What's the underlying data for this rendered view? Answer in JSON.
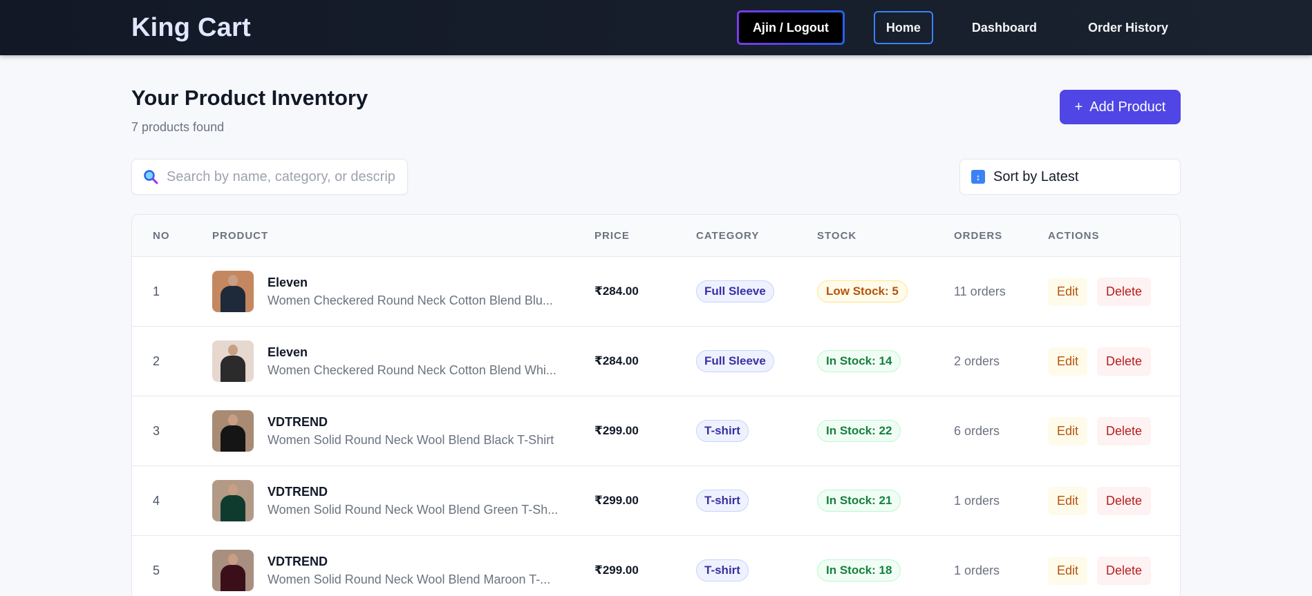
{
  "nav": {
    "brand": "King Cart",
    "logout_label": "Ajin / Logout",
    "links": [
      "Home",
      "Dashboard",
      "Order History"
    ]
  },
  "header": {
    "title": "Your Product Inventory",
    "count_text": "7 products found",
    "add_button": "Add Product",
    "add_icon": "+"
  },
  "search": {
    "placeholder": "Search by name, category, or description",
    "value": ""
  },
  "sort": {
    "label": "Sort by Latest"
  },
  "table": {
    "headers": [
      "NO",
      "PRODUCT",
      "PRICE",
      "CATEGORY",
      "STOCK",
      "ORDERS",
      "ACTIONS"
    ],
    "rows": [
      {
        "no": "1",
        "name": "Eleven",
        "desc": "Women Checkered Round Neck Cotton Blend Blu...",
        "price": "₹284.00",
        "category": "Full Sleeve",
        "stock": "Low Stock: 5",
        "stock_status": "low",
        "orders": "11 orders",
        "edit": "Edit",
        "delete": "Delete",
        "thumb_colors": [
          "#c58760",
          "#1e2a3a"
        ]
      },
      {
        "no": "2",
        "name": "Eleven",
        "desc": "Women Checkered Round Neck Cotton Blend Whi...",
        "price": "₹284.00",
        "category": "Full Sleeve",
        "stock": "In Stock: 14",
        "stock_status": "in",
        "orders": "2 orders",
        "edit": "Edit",
        "delete": "Delete",
        "thumb_colors": [
          "#e6d8cf",
          "#2b2b2b"
        ]
      },
      {
        "no": "3",
        "name": "VDTREND",
        "desc": "Women Solid Round Neck Wool Blend Black T-Shirt",
        "price": "₹299.00",
        "category": "T-shirt",
        "stock": "In Stock: 22",
        "stock_status": "in",
        "orders": "6 orders",
        "edit": "Edit",
        "delete": "Delete",
        "thumb_colors": [
          "#a98a72",
          "#151515"
        ]
      },
      {
        "no": "4",
        "name": "VDTREND",
        "desc": "Women Solid Round Neck Wool Blend Green T-Sh...",
        "price": "₹299.00",
        "category": "T-shirt",
        "stock": "In Stock: 21",
        "stock_status": "in",
        "orders": "1 orders",
        "edit": "Edit",
        "delete": "Delete",
        "thumb_colors": [
          "#b39a86",
          "#0f3b2e"
        ]
      },
      {
        "no": "5",
        "name": "VDTREND",
        "desc": "Women Solid Round Neck Wool Blend Maroon T-...",
        "price": "₹299.00",
        "category": "T-shirt",
        "stock": "In Stock: 18",
        "stock_status": "in",
        "orders": "1 orders",
        "edit": "Edit",
        "delete": "Delete",
        "thumb_colors": [
          "#a88f80",
          "#3a0f1a"
        ]
      }
    ]
  }
}
